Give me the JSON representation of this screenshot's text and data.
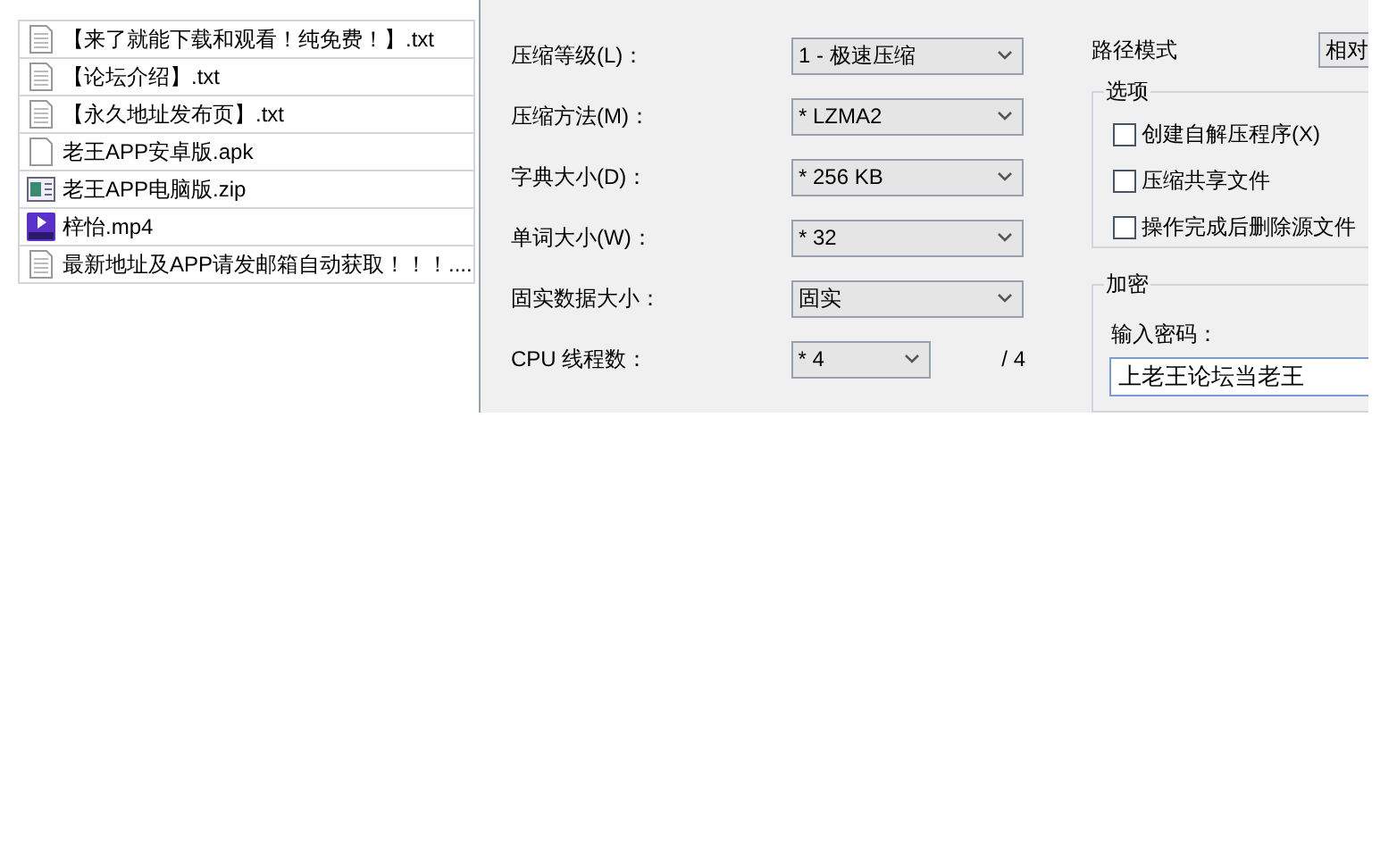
{
  "files": [
    {
      "name": "【来了就能下载和观看！纯免费！】.txt",
      "kind": "text"
    },
    {
      "name": "【论坛介绍】.txt",
      "kind": "text"
    },
    {
      "name": "【永久地址发布页】.txt",
      "kind": "text"
    },
    {
      "name": "老王APP安卓版.apk",
      "kind": "blank"
    },
    {
      "name": "老王APP电脑版.zip",
      "kind": "archive"
    },
    {
      "name": "梓怡.mp4",
      "kind": "video"
    },
    {
      "name": "最新地址及APP请发邮箱自动获取！！！....",
      "kind": "text"
    }
  ],
  "settings": [
    {
      "label": "压缩等级(L)：",
      "value": "1 - 极速压缩",
      "kind": "dropdown"
    },
    {
      "label": "压缩方法(M)：",
      "value": "* LZMA2",
      "kind": "dropdown"
    },
    {
      "label": "字典大小(D)：",
      "value": "* 256 KB",
      "kind": "dropdown"
    },
    {
      "label": "单词大小(W)：",
      "value": "* 32",
      "kind": "dropdown"
    },
    {
      "label": "固实数据大小：",
      "value": "固实",
      "kind": "dropdown"
    },
    {
      "label": "CPU 线程数：",
      "value": "* 4",
      "kind": "small_dropdown",
      "note": "/ 4"
    }
  ],
  "path_mode": {
    "label": "路径模式",
    "value": "相对"
  },
  "options": {
    "title": "选项",
    "items": [
      {
        "label": "创建自解压程序(X)",
        "checked": false
      },
      {
        "label": "压缩共享文件",
        "checked": false
      },
      {
        "label": "操作完成后删除源文件",
        "checked": false
      }
    ]
  },
  "encryption": {
    "title": "加密",
    "password_label": "输入密码：",
    "password": "上老王论坛当老王"
  }
}
